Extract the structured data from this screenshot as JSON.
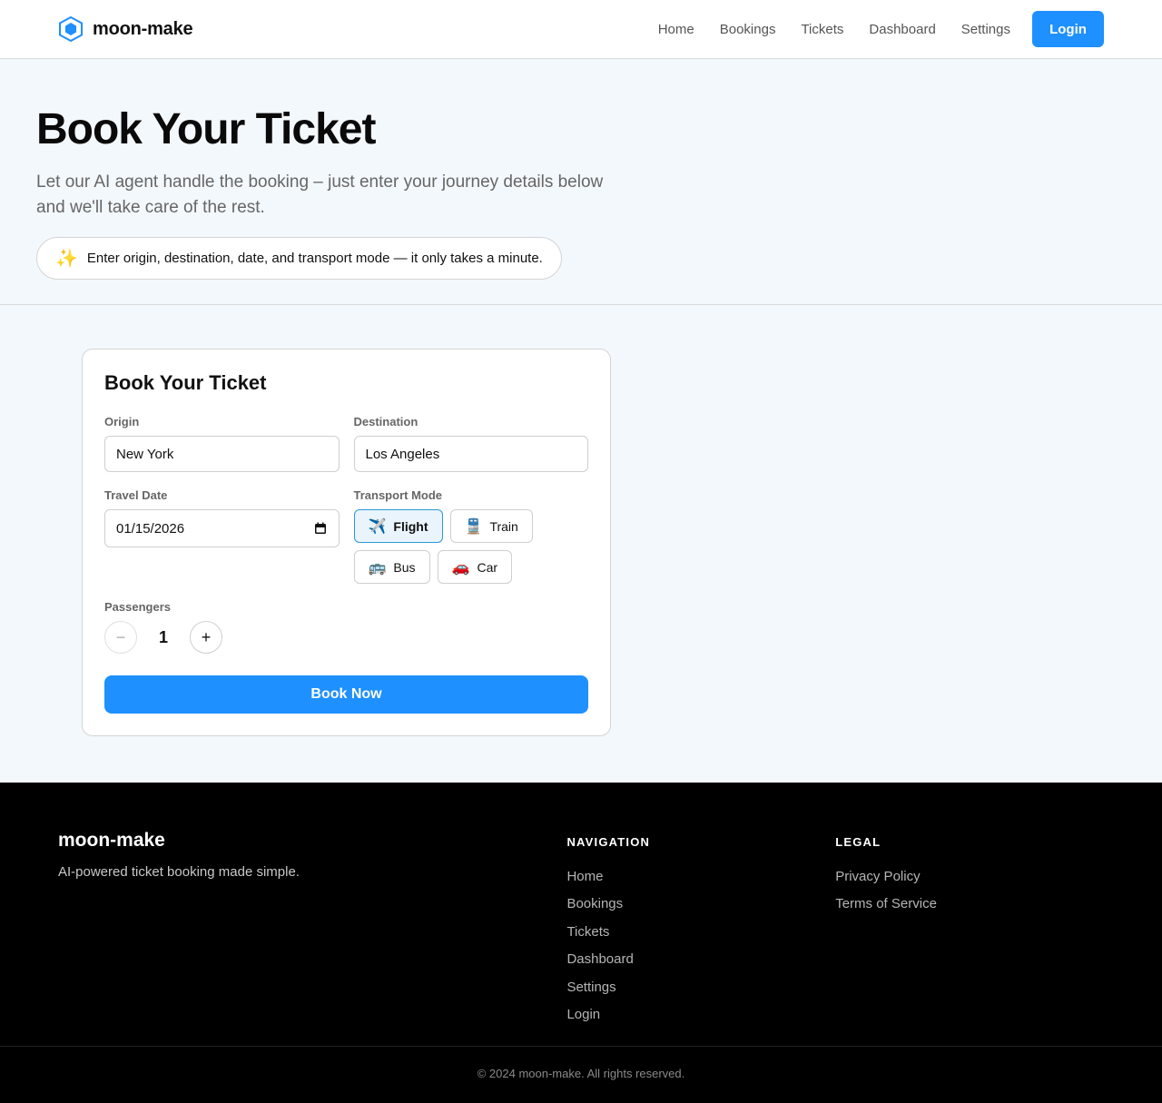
{
  "header": {
    "brand": "moon-make",
    "nav": [
      "Home",
      "Bookings",
      "Tickets",
      "Dashboard",
      "Settings"
    ],
    "login_label": "Login",
    "accent_color": "#1e90ff"
  },
  "hero": {
    "title": "Book Your Ticket",
    "subtitle": "Let our AI agent handle the booking – just enter your journey details below and we'll take care of the rest.",
    "pill_icon": "sparkles-icon",
    "pill_text": "Enter origin, destination, date, and transport mode — it only takes a minute."
  },
  "form": {
    "title": "Book Your Ticket",
    "origin_label": "Origin",
    "origin_value": "New York",
    "destination_label": "Destination",
    "destination_value": "Los Angeles",
    "date_label": "Travel Date",
    "date_value": "01/15/2026",
    "mode_label": "Transport Mode",
    "modes": [
      {
        "emoji": "✈️",
        "label": "Flight",
        "selected": true
      },
      {
        "emoji": "🚆",
        "label": "Train",
        "selected": false
      },
      {
        "emoji": "🚌",
        "label": "Bus",
        "selected": false
      },
      {
        "emoji": "🚗",
        "label": "Car",
        "selected": false
      }
    ],
    "passengers_label": "Passengers",
    "passengers_value": "1",
    "minus": "−",
    "plus": "+",
    "submit_label": "Book Now"
  },
  "footer": {
    "brand": "moon-make",
    "tagline": "AI-powered ticket booking made simple.",
    "nav_title": "NAVIGATION",
    "nav_links": [
      "Home",
      "Bookings",
      "Tickets",
      "Dashboard",
      "Settings",
      "Login"
    ],
    "legal_title": "LEGAL",
    "legal_links": [
      "Privacy Policy",
      "Terms of Service"
    ],
    "copyright": "© 2024 moon-make. All rights reserved."
  }
}
